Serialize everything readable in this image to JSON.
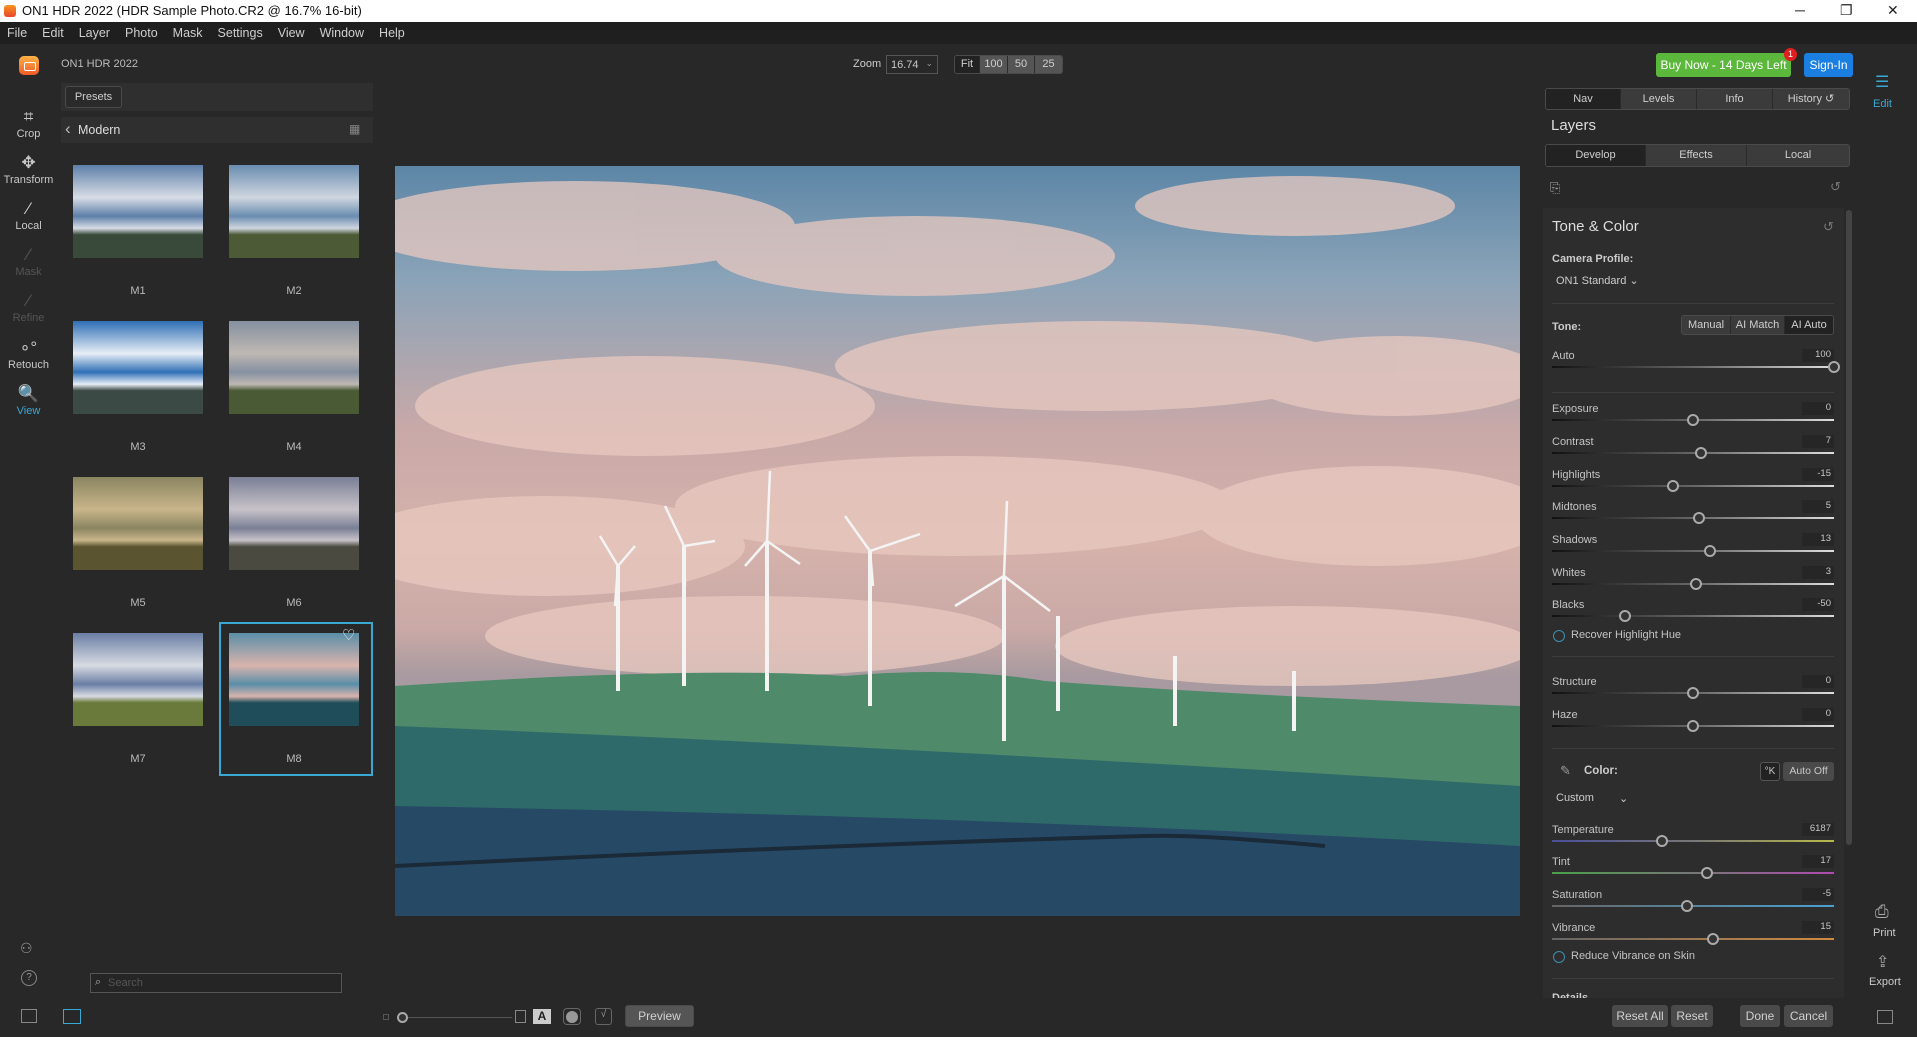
{
  "window": {
    "title": "ON1 HDR 2022 (HDR Sample Photo.CR2 @ 16.7% 16-bit)",
    "minimize": "─",
    "maximize": "❐",
    "close": "✕"
  },
  "menu": [
    "File",
    "Edit",
    "Layer",
    "Photo",
    "Mask",
    "Settings",
    "View",
    "Window",
    "Help"
  ],
  "app_name": "ON1 HDR 2022",
  "tools": [
    {
      "label": "Crop",
      "icon": "crop-icon",
      "glyph": "⌗"
    },
    {
      "label": "Transform",
      "icon": "transform-icon",
      "glyph": "✥"
    },
    {
      "label": "Local",
      "icon": "brush-icon",
      "glyph": "⁄"
    },
    {
      "label": "Mask",
      "icon": "mask-brush-icon",
      "glyph": "⁄"
    },
    {
      "label": "Refine",
      "icon": "refine-brush-icon",
      "glyph": "⁄"
    },
    {
      "label": "Retouch",
      "icon": "retouch-icon",
      "glyph": "∘°"
    },
    {
      "label": "View",
      "icon": "view-zoom-icon",
      "glyph": "🔍"
    }
  ],
  "presets": {
    "tab": "Presets",
    "category": "Modern",
    "items": [
      "M1",
      "M2",
      "M3",
      "M4",
      "M5",
      "M6",
      "M7",
      "M8"
    ],
    "selected": "M8",
    "search_placeholder": "Search"
  },
  "zoom": {
    "label": "Zoom",
    "value": "16.74",
    "buttons": [
      "Fit",
      "100",
      "50",
      "25"
    ],
    "active": "Fit"
  },
  "header": {
    "buy": "Buy Now - 14 Days Left",
    "badge": "1",
    "signin": "Sign-In",
    "buy_color": "#5cb83c",
    "signin_color": "#1a7fe0"
  },
  "right_rail": {
    "edit": "Edit",
    "print": "Print",
    "export": "Export"
  },
  "nav_tabs": [
    "Nav",
    "Levels",
    "Info",
    "History"
  ],
  "layers_title": "Layers",
  "layer_tabs": [
    "Develop",
    "Effects",
    "Local"
  ],
  "tone_color": {
    "title": "Tone & Color",
    "camera_profile_label": "Camera Profile:",
    "camera_profile": "ON1 Standard",
    "tone_label": "Tone:",
    "tone_modes": [
      "Manual",
      "AI Match",
      "AI Auto"
    ],
    "tone_mode_active": "AI Auto",
    "recover": "Recover Highlight Hue",
    "color_label": "Color:",
    "kelvin": "°K",
    "auto_off": "Auto Off",
    "wb_preset": "Custom",
    "reduce_vibrance": "Reduce Vibrance on Skin",
    "next_section": "Details"
  },
  "sliders": [
    {
      "name": "Auto",
      "value": "100",
      "level": 1.0
    },
    {
      "name": "Exposure",
      "value": "0",
      "level": 0.5
    },
    {
      "name": "Contrast",
      "value": "7",
      "level": 0.53
    },
    {
      "name": "Highlights",
      "value": "-15",
      "level": 0.43
    },
    {
      "name": "Midtones",
      "value": "5",
      "level": 0.52
    },
    {
      "name": "Shadows",
      "value": "13",
      "level": 0.56
    },
    {
      "name": "Whites",
      "value": "3",
      "level": 0.51
    },
    {
      "name": "Blacks",
      "value": "-50",
      "level": 0.26
    },
    {
      "name": "Structure",
      "value": "0",
      "level": 0.5
    },
    {
      "name": "Haze",
      "value": "0",
      "level": 0.5
    },
    {
      "name": "Temperature",
      "value": "6187",
      "level": 0.39
    },
    {
      "name": "Tint",
      "value": "17",
      "level": 0.55
    },
    {
      "name": "Saturation",
      "value": "-5",
      "level": 0.48
    },
    {
      "name": "Vibrance",
      "value": "15",
      "level": 0.57
    }
  ],
  "bottom": {
    "preview": "Preview",
    "reset_all": "Reset All",
    "reset": "Reset",
    "done": "Done",
    "cancel": "Cancel"
  },
  "accent_color": "#39a9d3"
}
